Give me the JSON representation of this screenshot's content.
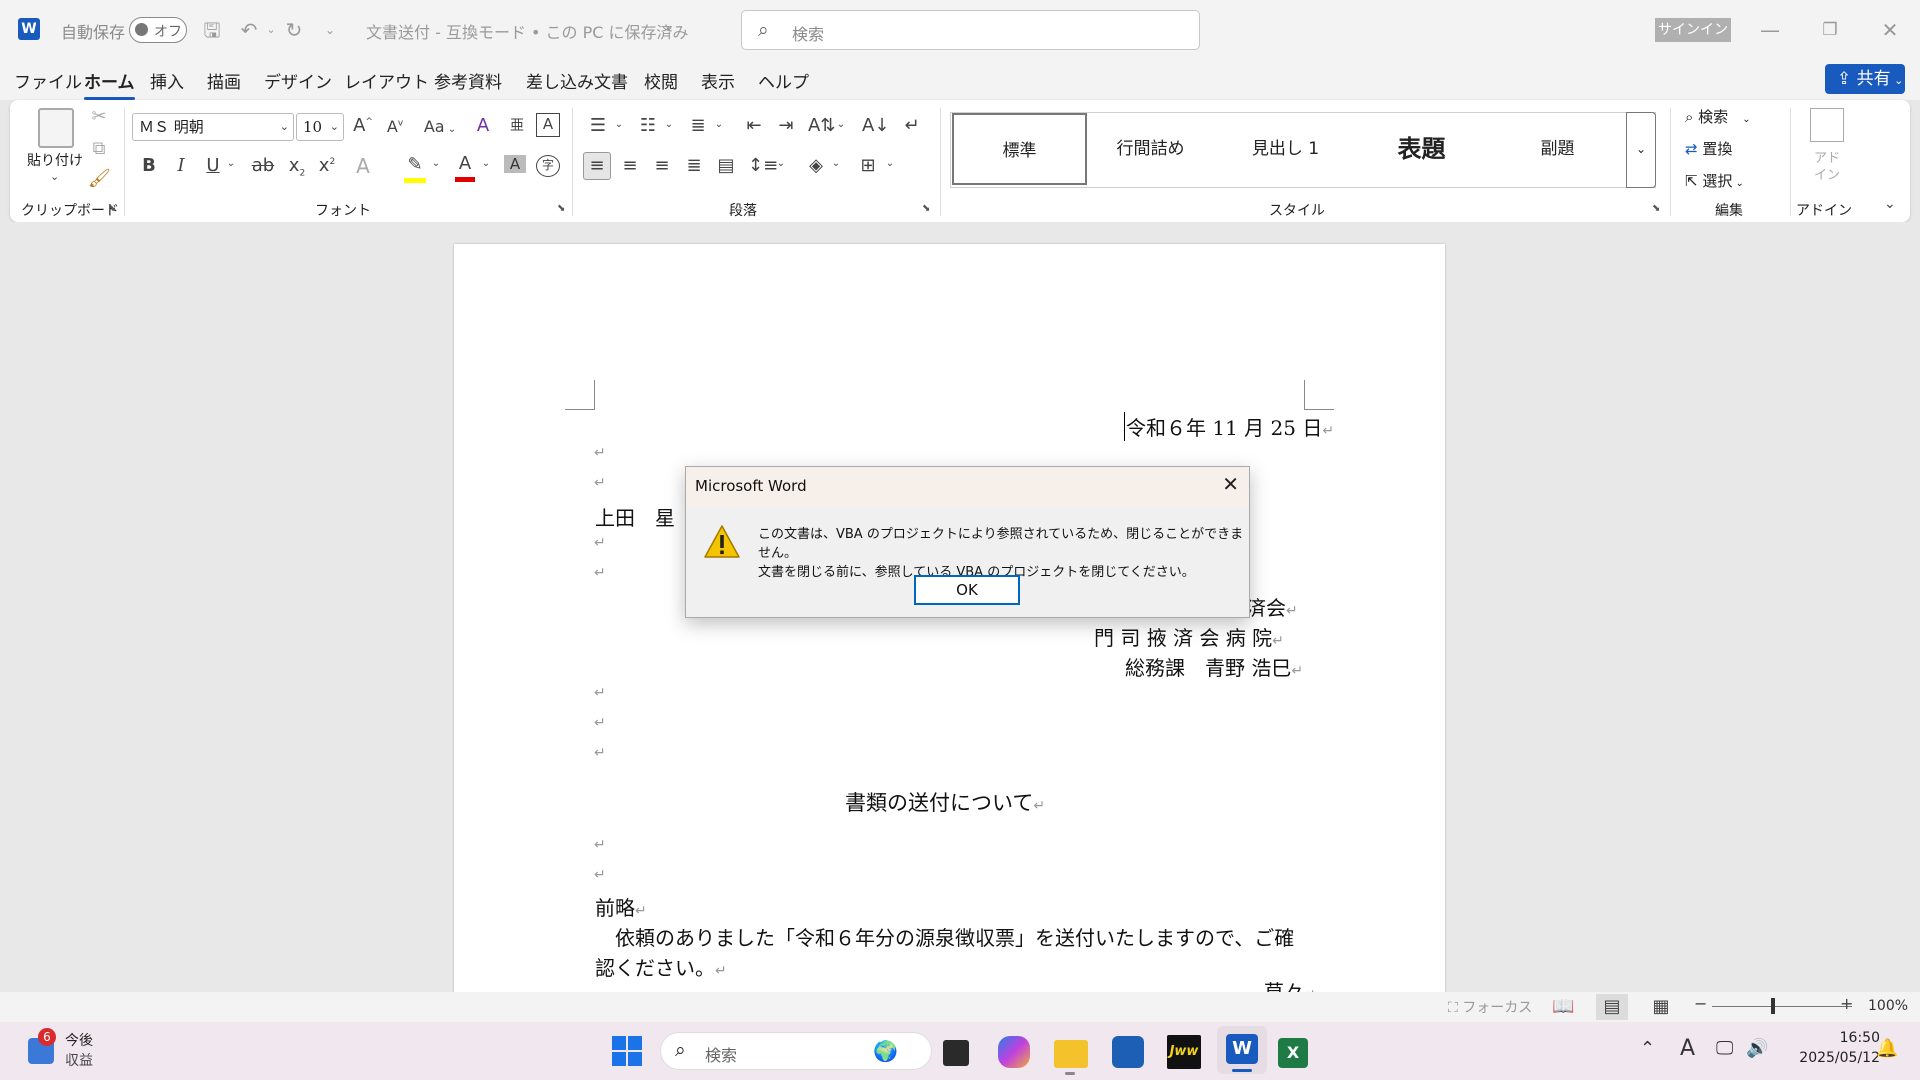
{
  "titlebar": {
    "autosave_label": "自動保存",
    "autosave_state": "オフ",
    "doc_title": "文書送付 - 互換モード • この PC に保存済み",
    "search_placeholder": "検索",
    "signin_label": "サインイン"
  },
  "tabs": [
    "ファイル",
    "ホーム",
    "挿入",
    "描画",
    "デザイン",
    "レイアウト",
    "参考資料",
    "差し込み文書",
    "校閲",
    "表示",
    "ヘルプ"
  ],
  "active_tab": "ホーム",
  "share_label": "共有",
  "ribbon": {
    "clipboard": {
      "paste_label": "貼り付け",
      "group_label": "クリップボード"
    },
    "font": {
      "font_name": "ＭＳ 明朝",
      "font_size": "10",
      "group_label": "フォント",
      "case_label": "Aa"
    },
    "paragraph": {
      "group_label": "段落"
    },
    "styles": {
      "items": [
        "標準",
        "行間詰め",
        "見出し 1",
        "表題",
        "副題"
      ],
      "group_label": "スタイル"
    },
    "editing": {
      "find": "検索",
      "replace": "置換",
      "select": "選択",
      "group_label": "編集"
    },
    "addins": {
      "label": "アド\nイン",
      "group_label": "アドイン"
    }
  },
  "document": {
    "date": "令和６年 11 月 25 日",
    "recipient": "上田　星",
    "sender_org_partial": "済会",
    "sender_hospital": "門 司 掖 済 会 病 院",
    "sender_dept": "総務課　青野 浩巳",
    "subject": "書類の送付について",
    "greeting": "前略",
    "body_line1": "　依頼のありました「令和６年分の源泉徴収票」を送付いたしますので、ご確",
    "body_line2": "認ください。",
    "closing_partial": "草々",
    "para_mark": "↵"
  },
  "dialog": {
    "title": "Microsoft Word",
    "message_line1": "この文書は、VBA のプロジェクトにより参照されているため、閉じることができません。",
    "message_line2": "文書を閉じる前に、参照している VBA のプロジェクトを閉じてください。",
    "ok_label": "OK",
    "icon": "warning-icon"
  },
  "statusbar": {
    "focus_label": "フォーカス",
    "zoom": "100%"
  },
  "taskbar": {
    "widget_badge": "6",
    "widget_line1": "今後",
    "widget_line2": "収益",
    "search_placeholder": "検索",
    "time": "16:50",
    "date": "2025/05/12",
    "ime": "A"
  }
}
